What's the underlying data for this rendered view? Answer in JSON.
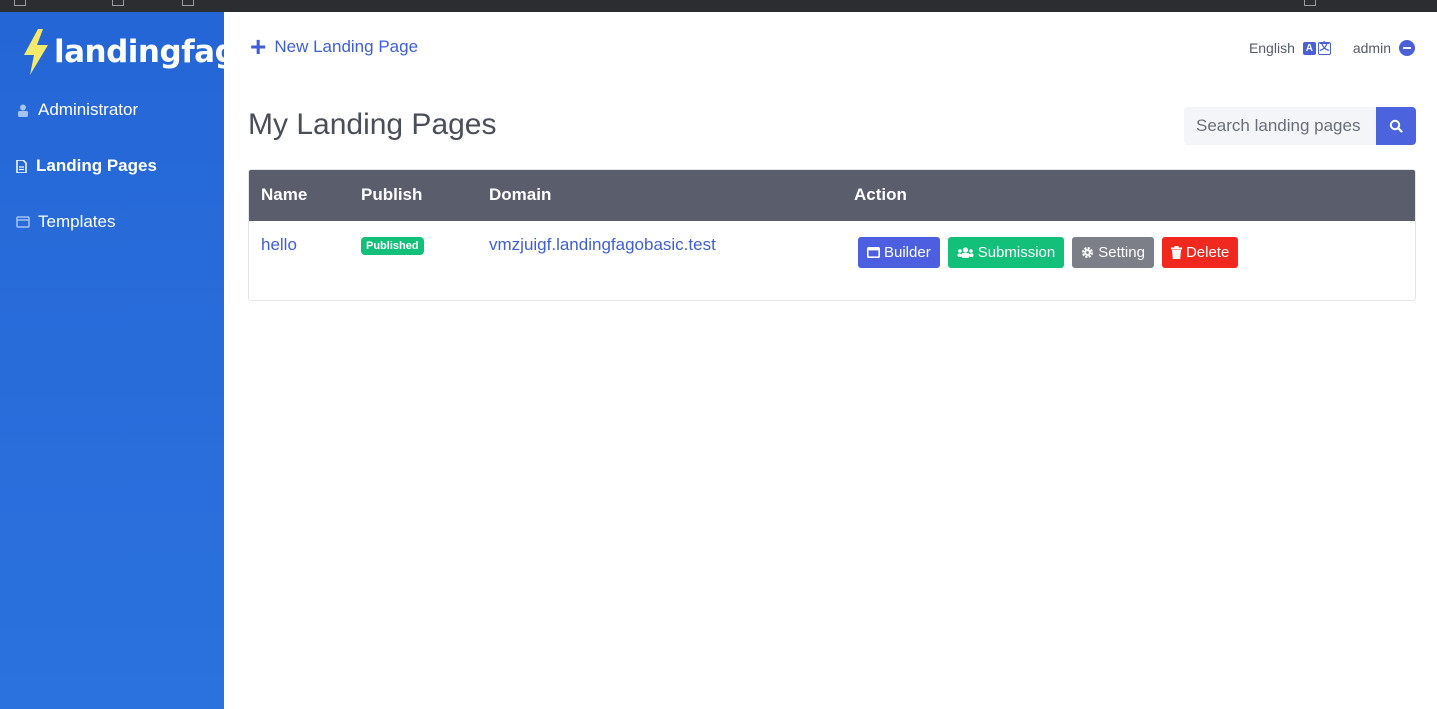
{
  "app": {
    "logo_text": "landingfago"
  },
  "sidebar": {
    "items": [
      {
        "label": "Administrator",
        "icon": "user-lock-icon",
        "active": false
      },
      {
        "label": "Landing Pages",
        "icon": "file-icon",
        "active": true
      },
      {
        "label": "Templates",
        "icon": "window-icon",
        "active": false
      }
    ]
  },
  "header": {
    "new_page_label": "New Landing Page",
    "language_label": "English",
    "language_icon": "translate-icon",
    "user_label": "admin",
    "user_icon": "user-circle-icon"
  },
  "main": {
    "title": "My Landing Pages",
    "search": {
      "placeholder": "Search landing pages",
      "value": ""
    }
  },
  "table": {
    "columns": [
      "Name",
      "Publish",
      "Domain",
      "Action"
    ],
    "rows": [
      {
        "name": "hello",
        "status": "Published",
        "domain": "vmzjuigf.landingfagobasic.test",
        "actions": {
          "builder": "Builder",
          "submission": "Submission",
          "setting": "Setting",
          "delete": "Delete"
        }
      }
    ]
  },
  "colors": {
    "sidebar": "#2566d6",
    "accent": "#3f5fd9",
    "table_header": "#5a5d6b",
    "success": "#13c07a",
    "danger": "#f0281e",
    "secondary": "#7c7f88"
  }
}
